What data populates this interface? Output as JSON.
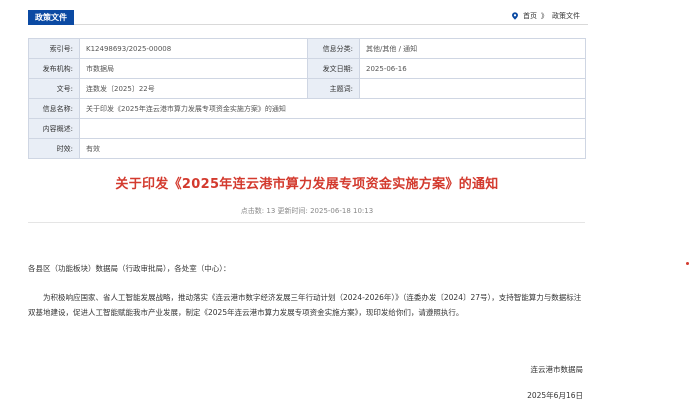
{
  "topbar": {
    "section_tab": "政策文件",
    "breadcrumb": {
      "home": "首页",
      "separator": "》",
      "current": "政策文件"
    },
    "accent": "#0b4aa3"
  },
  "info": {
    "index_label": "索引号:",
    "index_value": "K12498693/2025-00008",
    "category_label": "信息分类:",
    "category_value": "其他/其他 / 通知",
    "agency_label": "发布机构:",
    "agency_value": "市数据局",
    "date_label": "发文日期:",
    "date_value": "2025-06-16",
    "docno_label": "文号:",
    "docno_value": "连数发〔2025〕22号",
    "keywords_label": "主题词:",
    "keywords_value": "",
    "name_label": "信息名称:",
    "name_value": "关于印发《2025年连云港市算力发展专项资金实施方案》的通知",
    "summary_label": "内容概述:",
    "summary_value": "",
    "validity_label": "时效:",
    "validity_value": "有效"
  },
  "article": {
    "title": "关于印发《2025年连云港市算力发展专项资金实施方案》的通知",
    "meta": "点击数: 13 更新时间: 2025-06-18 10:13",
    "salutation": "各县区（功能板块）数据局（行政审批局），各处室（中心）：",
    "paragraph": "为积极响应国家、省人工智能发展战略，推动落实《连云港市数字经济发展三年行动计划（2024-2026年）》（连委办发〔2024〕27号），支持智能算力与数据标注双基地建设，促进人工智能赋能我市产业发展，制定《2025年连云港市算力发展专项资金实施方案》，现印发给你们，请遵照执行。",
    "signature": "连云港市数据局",
    "date": "2025年6月16日",
    "title_color": "#d33a2e"
  }
}
